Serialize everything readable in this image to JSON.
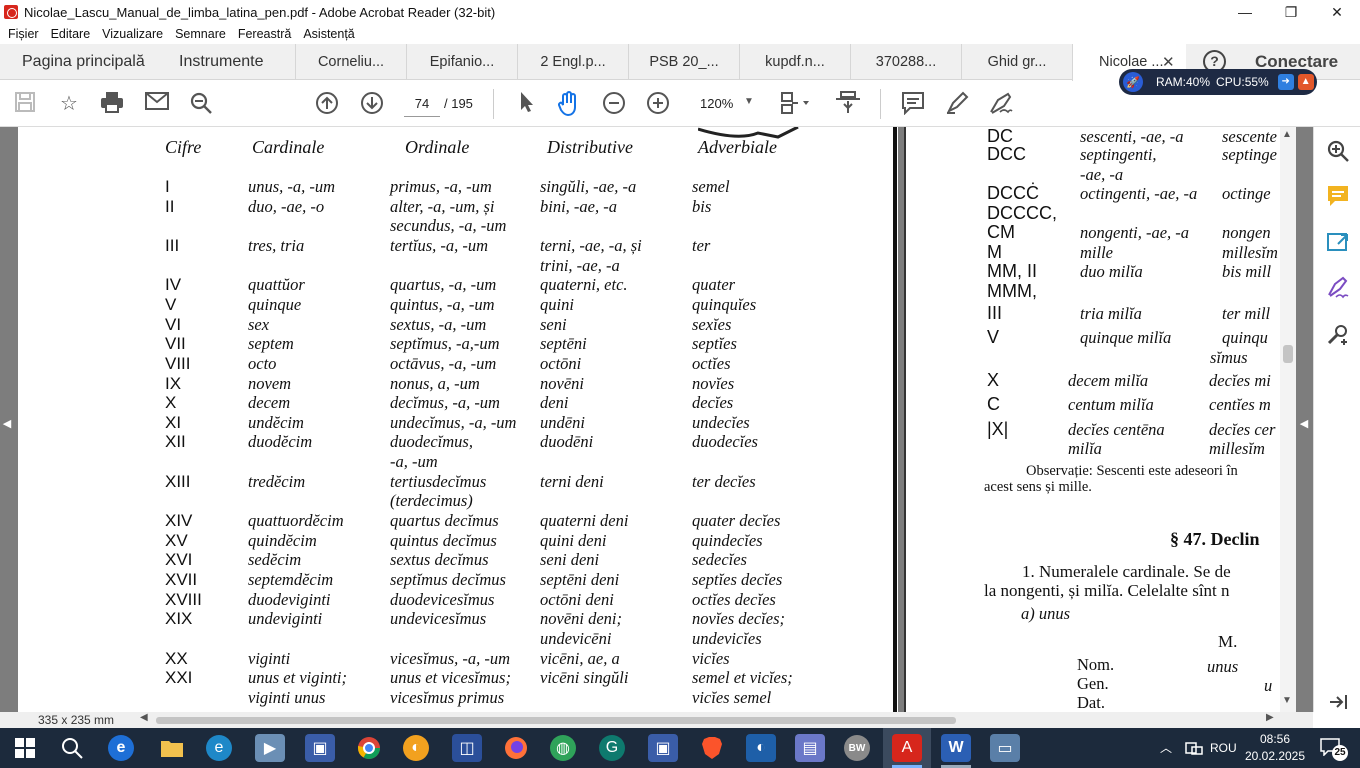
{
  "window": {
    "title": "Nicolae_Lascu_Manual_de_limba_latina_pen.pdf - Adobe Acrobat Reader (32-bit)",
    "minimize": "—",
    "maximize": "❐",
    "close": "✕"
  },
  "menu": [
    "Fișier",
    "Editare",
    "Vizualizare",
    "Semnare",
    "Fereastră",
    "Asistență"
  ],
  "tabs": {
    "home": "Pagina principală",
    "tools": "Instrumente",
    "docs": [
      "Corneliu...",
      "Epifanio...",
      "2 Engl.p...",
      "PSB 20_...",
      "kupdf.n...",
      "370288...",
      "Ghid gr...",
      "Nicolae ..."
    ],
    "close": "✕",
    "help": "?",
    "signin": "Conectare"
  },
  "monitor": {
    "ram": "RAM:40%",
    "cpu": "CPU:55%"
  },
  "toolbar": {
    "page_current": "74",
    "page_total": "/ 195",
    "zoom": "120%"
  },
  "left_page": {
    "headers": [
      "Cifre",
      "Cardinale",
      "Ordinale",
      "Distributive",
      "Adverbiale"
    ],
    "rows": [
      {
        "c": "I",
        "card": "unus, -a, -um",
        "ord": "primus, -a, -um",
        "dist": "singŭli, -ae, -a",
        "adv": "semel"
      },
      {
        "c": "II",
        "card": "duo, -ae, -o",
        "ord": "alter, -a, -um, și",
        "dist": "bini, -ae, -a",
        "adv": "bis"
      },
      {
        "c": "",
        "card": "",
        "ord": "secundus, -a, -um",
        "dist": "",
        "adv": ""
      },
      {
        "c": "III",
        "card": "tres, tria",
        "ord": "tertĭus, -a, -um",
        "dist": "terni, -ae, -a, și",
        "adv": "ter"
      },
      {
        "c": "",
        "card": "",
        "ord": "",
        "dist": "trini, -ae, -a",
        "adv": ""
      },
      {
        "c": "IV",
        "card": "quattŭor",
        "ord": "quartus, -a, -um",
        "dist": "quaterni, etc.",
        "adv": "quater"
      },
      {
        "c": "V",
        "card": "quinque",
        "ord": "quintus, -a, -um",
        "dist": "quini",
        "adv": "quinquĭes"
      },
      {
        "c": "VI",
        "card": "sex",
        "ord": "sextus, -a, -um",
        "dist": "seni",
        "adv": "sexĭes"
      },
      {
        "c": "VII",
        "card": "septem",
        "ord": "septĭmus, -a,-um",
        "dist": "septēni",
        "adv": "septĭes"
      },
      {
        "c": "VIII",
        "card": "octo",
        "ord": "octāvus, -a, -um",
        "dist": "octōni",
        "adv": "octĭes"
      },
      {
        "c": "IX",
        "card": "novem",
        "ord": "nonus, a, -um",
        "dist": "novēni",
        "adv": "novĭes"
      },
      {
        "c": "X",
        "card": "decem",
        "ord": "decĭmus, -a, -um",
        "dist": "deni",
        "adv": "decĭes"
      },
      {
        "c": "XI",
        "card": "undĕcim",
        "ord": "undecĭmus, -a, -um",
        "dist": "undēni",
        "adv": "undecĭes"
      },
      {
        "c": "XII",
        "card": "duodĕcim",
        "ord": "duodecĭmus,",
        "dist": "duodēni",
        "adv": "duodecĭes"
      },
      {
        "c": "",
        "card": "",
        "ord": "-a, -um",
        "dist": "",
        "adv": ""
      },
      {
        "c": "XIII",
        "card": "tredĕcim",
        "ord": "tertiusdecĭmus",
        "dist": "terni deni",
        "adv": "ter decĭes"
      },
      {
        "c": "",
        "card": "",
        "ord": "(terdecimus)",
        "dist": "",
        "adv": ""
      },
      {
        "c": "XIV",
        "card": "quattuordĕcim",
        "ord": "quartus decĭmus",
        "dist": "quaterni deni",
        "adv": "quater decĭes"
      },
      {
        "c": "XV",
        "card": "quindĕcim",
        "ord": "quintus decĭmus",
        "dist": "quini deni",
        "adv": "quindecĭes"
      },
      {
        "c": "XVI",
        "card": "sedĕcim",
        "ord": "sextus decĭmus",
        "dist": "seni deni",
        "adv": "sedecĭes"
      },
      {
        "c": "XVII",
        "card": "septemdĕcim",
        "ord": "septĭmus decĭmus",
        "dist": "septēni deni",
        "adv": "septĭes decĭes"
      },
      {
        "c": "XVIII",
        "card": "duodeviginti",
        "ord": "duodevicesĭmus",
        "dist": "octōni deni",
        "adv": "octĭes decĭes"
      },
      {
        "c": "XIX",
        "card": "undeviginti",
        "ord": "undevicesĭmus",
        "dist": "novēni deni;",
        "adv": "novĭes decĭes;"
      },
      {
        "c": "",
        "card": "",
        "ord": "",
        "dist": "undevicēni",
        "adv": "undevicĭes"
      },
      {
        "c": "XX",
        "card": "viginti",
        "ord": "vicesĭmus, -a, -um",
        "dist": "vicēni, ae, a",
        "adv": "vicĭes"
      },
      {
        "c": "XXI",
        "card": "unus et viginti;",
        "ord": "unus et vicesĭmus;",
        "dist": "vicēni singŭli",
        "adv": "semel et vicĭes;"
      },
      {
        "c": "",
        "card": "viginti unus",
        "ord": "vicesĭmus primus",
        "dist": "",
        "adv": "vicĭes semel"
      }
    ]
  },
  "right_page": {
    "rows": [
      {
        "c": "DC",
        "a": "sescenti, -ae, -a",
        "b": "sescente"
      },
      {
        "c": "DCC",
        "a": "septingenti,",
        "b": "septinge"
      },
      {
        "c": "",
        "a": "-ae, -a",
        "b": ""
      },
      {
        "c": "DCCĊ",
        "a": "octingenti, -ae, -a",
        "b": "octinge"
      },
      {
        "c": "DCCCC,",
        "a": "",
        "b": ""
      },
      {
        "c": "CM",
        "a": "nongenti, -ae, -a",
        "b": "nongen"
      },
      {
        "c": "M",
        "a": "mille",
        "b": "millesĭm"
      },
      {
        "c": "MM, II",
        "a": "duo milĭa",
        "b": "bis mill"
      },
      {
        "c": "MMM,",
        "a": "",
        "b": ""
      },
      {
        "c": "III",
        "a": "tria milĭa",
        "b": "ter mill"
      },
      {
        "c": "V",
        "a": "quinque milĭa",
        "b": "quinqu"
      },
      {
        "c": "",
        "a": "",
        "b": "sĭmus"
      },
      {
        "c": "X",
        "a": "decem milĭa",
        "b": "decĭes mi"
      },
      {
        "c": "C",
        "a": "centum milĭa",
        "b": "centĭes m"
      },
      {
        "c": "|X|",
        "a": "decĭes centēna",
        "b": "decĭes cer"
      },
      {
        "c": "",
        "a": "milĭa",
        "b": "millesĭm"
      }
    ],
    "observation_1": "Observație: Sescenti este adeseori în",
    "observation_2": "acest sens și mille.",
    "section": "§ 47. Declin",
    "para_1": "1. Numeralele cardinale. Se de",
    "para_2": "la nongenti, și milĭa. Celelalte sînt n",
    "para_3": "a) unus",
    "m_label": "M.",
    "nom": "Nom.",
    "nom_val": "unus",
    "gen": "Gen.",
    "gen_val": "u",
    "dat": "Dat."
  },
  "status": {
    "size": "335 x 235 mm"
  },
  "taskbar": {
    "language": "ROU",
    "time": "08:56",
    "date": "20.02.2025",
    "notifications": "25"
  }
}
